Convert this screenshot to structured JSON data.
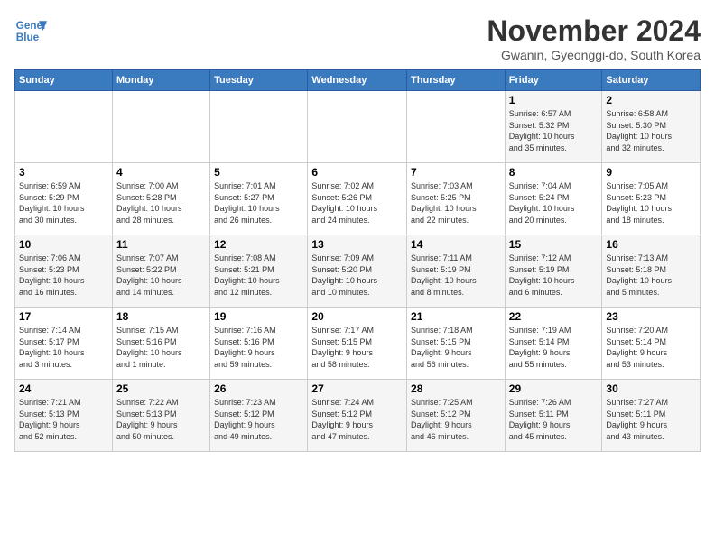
{
  "header": {
    "logo_line1": "General",
    "logo_line2": "Blue",
    "title": "November 2024",
    "subtitle": "Gwanin, Gyeonggi-do, South Korea"
  },
  "days_of_week": [
    "Sunday",
    "Monday",
    "Tuesday",
    "Wednesday",
    "Thursday",
    "Friday",
    "Saturday"
  ],
  "weeks": [
    [
      {
        "day": "",
        "info": ""
      },
      {
        "day": "",
        "info": ""
      },
      {
        "day": "",
        "info": ""
      },
      {
        "day": "",
        "info": ""
      },
      {
        "day": "",
        "info": ""
      },
      {
        "day": "1",
        "info": "Sunrise: 6:57 AM\nSunset: 5:32 PM\nDaylight: 10 hours\nand 35 minutes."
      },
      {
        "day": "2",
        "info": "Sunrise: 6:58 AM\nSunset: 5:30 PM\nDaylight: 10 hours\nand 32 minutes."
      }
    ],
    [
      {
        "day": "3",
        "info": "Sunrise: 6:59 AM\nSunset: 5:29 PM\nDaylight: 10 hours\nand 30 minutes."
      },
      {
        "day": "4",
        "info": "Sunrise: 7:00 AM\nSunset: 5:28 PM\nDaylight: 10 hours\nand 28 minutes."
      },
      {
        "day": "5",
        "info": "Sunrise: 7:01 AM\nSunset: 5:27 PM\nDaylight: 10 hours\nand 26 minutes."
      },
      {
        "day": "6",
        "info": "Sunrise: 7:02 AM\nSunset: 5:26 PM\nDaylight: 10 hours\nand 24 minutes."
      },
      {
        "day": "7",
        "info": "Sunrise: 7:03 AM\nSunset: 5:25 PM\nDaylight: 10 hours\nand 22 minutes."
      },
      {
        "day": "8",
        "info": "Sunrise: 7:04 AM\nSunset: 5:24 PM\nDaylight: 10 hours\nand 20 minutes."
      },
      {
        "day": "9",
        "info": "Sunrise: 7:05 AM\nSunset: 5:23 PM\nDaylight: 10 hours\nand 18 minutes."
      }
    ],
    [
      {
        "day": "10",
        "info": "Sunrise: 7:06 AM\nSunset: 5:23 PM\nDaylight: 10 hours\nand 16 minutes."
      },
      {
        "day": "11",
        "info": "Sunrise: 7:07 AM\nSunset: 5:22 PM\nDaylight: 10 hours\nand 14 minutes."
      },
      {
        "day": "12",
        "info": "Sunrise: 7:08 AM\nSunset: 5:21 PM\nDaylight: 10 hours\nand 12 minutes."
      },
      {
        "day": "13",
        "info": "Sunrise: 7:09 AM\nSunset: 5:20 PM\nDaylight: 10 hours\nand 10 minutes."
      },
      {
        "day": "14",
        "info": "Sunrise: 7:11 AM\nSunset: 5:19 PM\nDaylight: 10 hours\nand 8 minutes."
      },
      {
        "day": "15",
        "info": "Sunrise: 7:12 AM\nSunset: 5:19 PM\nDaylight: 10 hours\nand 6 minutes."
      },
      {
        "day": "16",
        "info": "Sunrise: 7:13 AM\nSunset: 5:18 PM\nDaylight: 10 hours\nand 5 minutes."
      }
    ],
    [
      {
        "day": "17",
        "info": "Sunrise: 7:14 AM\nSunset: 5:17 PM\nDaylight: 10 hours\nand 3 minutes."
      },
      {
        "day": "18",
        "info": "Sunrise: 7:15 AM\nSunset: 5:16 PM\nDaylight: 10 hours\nand 1 minute."
      },
      {
        "day": "19",
        "info": "Sunrise: 7:16 AM\nSunset: 5:16 PM\nDaylight: 9 hours\nand 59 minutes."
      },
      {
        "day": "20",
        "info": "Sunrise: 7:17 AM\nSunset: 5:15 PM\nDaylight: 9 hours\nand 58 minutes."
      },
      {
        "day": "21",
        "info": "Sunrise: 7:18 AM\nSunset: 5:15 PM\nDaylight: 9 hours\nand 56 minutes."
      },
      {
        "day": "22",
        "info": "Sunrise: 7:19 AM\nSunset: 5:14 PM\nDaylight: 9 hours\nand 55 minutes."
      },
      {
        "day": "23",
        "info": "Sunrise: 7:20 AM\nSunset: 5:14 PM\nDaylight: 9 hours\nand 53 minutes."
      }
    ],
    [
      {
        "day": "24",
        "info": "Sunrise: 7:21 AM\nSunset: 5:13 PM\nDaylight: 9 hours\nand 52 minutes."
      },
      {
        "day": "25",
        "info": "Sunrise: 7:22 AM\nSunset: 5:13 PM\nDaylight: 9 hours\nand 50 minutes."
      },
      {
        "day": "26",
        "info": "Sunrise: 7:23 AM\nSunset: 5:12 PM\nDaylight: 9 hours\nand 49 minutes."
      },
      {
        "day": "27",
        "info": "Sunrise: 7:24 AM\nSunset: 5:12 PM\nDaylight: 9 hours\nand 47 minutes."
      },
      {
        "day": "28",
        "info": "Sunrise: 7:25 AM\nSunset: 5:12 PM\nDaylight: 9 hours\nand 46 minutes."
      },
      {
        "day": "29",
        "info": "Sunrise: 7:26 AM\nSunset: 5:11 PM\nDaylight: 9 hours\nand 45 minutes."
      },
      {
        "day": "30",
        "info": "Sunrise: 7:27 AM\nSunset: 5:11 PM\nDaylight: 9 hours\nand 43 minutes."
      }
    ]
  ]
}
